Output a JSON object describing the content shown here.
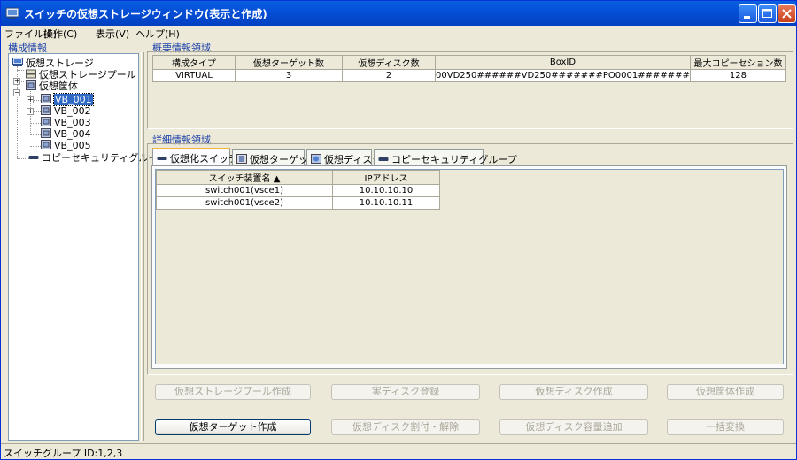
{
  "window": {
    "title": "スイッチの仮想ストレージウィンドウ(表示と作成)"
  },
  "menu": [
    "ファイル(F)",
    "操作(C)",
    "表示(V)",
    "ヘルプ(H)"
  ],
  "left_panel": {
    "header": "構成情報",
    "tree": {
      "root": "仮想ストレージ",
      "pool": "仮想ストレージプール",
      "enclosure": "仮想筐体",
      "vb": [
        "VB_001",
        "VB_002",
        "VB_003",
        "VB_004",
        "VB_005"
      ],
      "copy_security": "コピーセキュリティグループ"
    }
  },
  "summary": {
    "header": "概要情報領域",
    "columns": [
      "構成タイプ",
      "仮想ターゲット数",
      "仮想ディスク数",
      "BoxID",
      "最大コピーセション数"
    ],
    "row": [
      "VIRTUAL",
      "3",
      "2",
      "00VD250######VD250#######PO0001#######",
      "128"
    ]
  },
  "detail": {
    "header": "詳細情報領域",
    "tabs": [
      "仮想化スイッチ",
      "仮想ターゲット",
      "仮想ディスク",
      "コピーセキュリティグループ"
    ],
    "columns": [
      "スイッチ装置名 ▲",
      "IPアドレス"
    ],
    "rows": [
      [
        "switch001(vsce1)",
        "10.10.10.10"
      ],
      [
        "switch001(vsce2)",
        "10.10.10.11"
      ]
    ]
  },
  "buttons": {
    "create_pool": "仮想ストレージプール作成",
    "register_disk": "実ディスク登録",
    "create_vdisk": "仮想ディスク作成",
    "create_enclosure": "仮想筐体作成",
    "create_target": "仮想ターゲット作成",
    "assign_disk": "仮想ディスク割付・解除",
    "expand_disk": "仮想ディスク容量追加",
    "bulk_convert": "一括変換"
  },
  "status": "スイッチグループ ID:1,2,3",
  "colors": {
    "titlebar": "#0450d8",
    "selection": "#316ac5",
    "header_text": "#1a3fa8",
    "active_tab": "#f2b439"
  }
}
